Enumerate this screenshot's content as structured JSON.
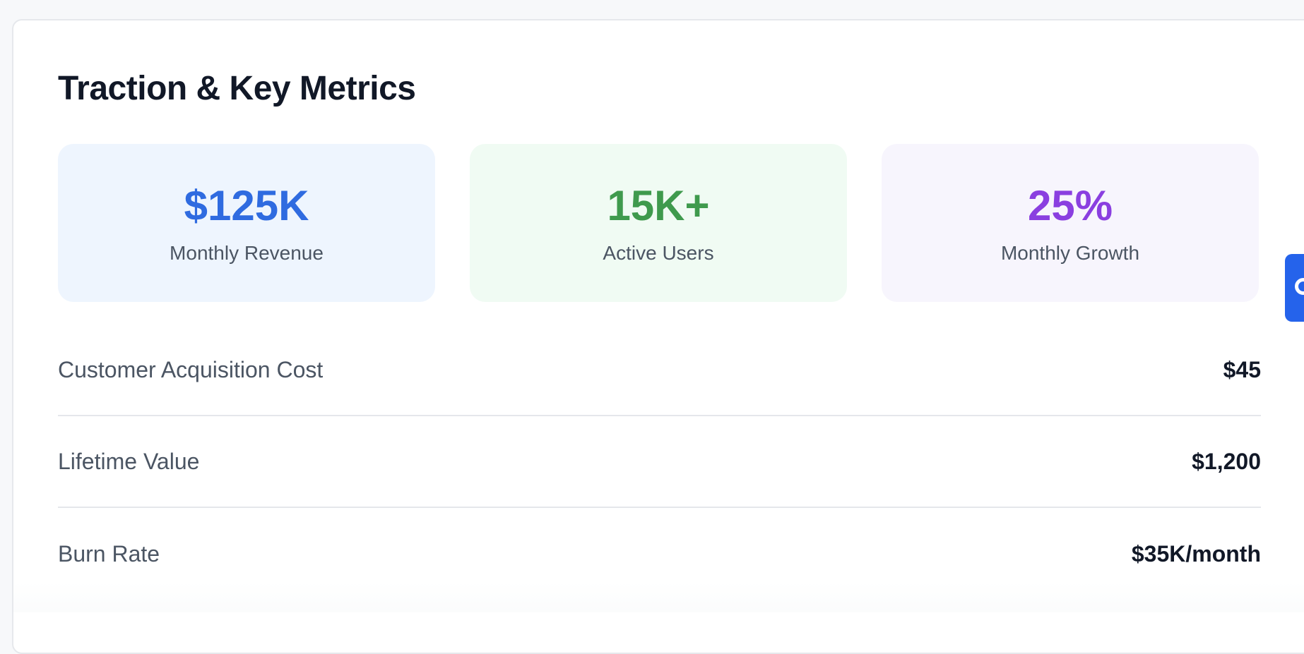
{
  "section": {
    "title": "Traction & Key Metrics"
  },
  "metrics": [
    {
      "value": "$125K",
      "label": "Monthly Revenue",
      "value_color": "#2f6be0",
      "bg_color": "#eef5fe"
    },
    {
      "value": "15K+",
      "label": "Active Users",
      "value_color": "#3f9a4d",
      "bg_color": "#f0fbf3"
    },
    {
      "value": "25%",
      "label": "Monthly Growth",
      "value_color": "#8a3fe0",
      "bg_color": "#f7f5fd"
    }
  ],
  "details": [
    {
      "label": "Customer Acquisition Cost",
      "value": "$45"
    },
    {
      "label": "Lifetime Value",
      "value": "$1,200"
    },
    {
      "label": "Burn Rate",
      "value": "$35K/month"
    }
  ],
  "side_tab": {
    "color": "#2563eb",
    "icon": "chat-icon"
  }
}
